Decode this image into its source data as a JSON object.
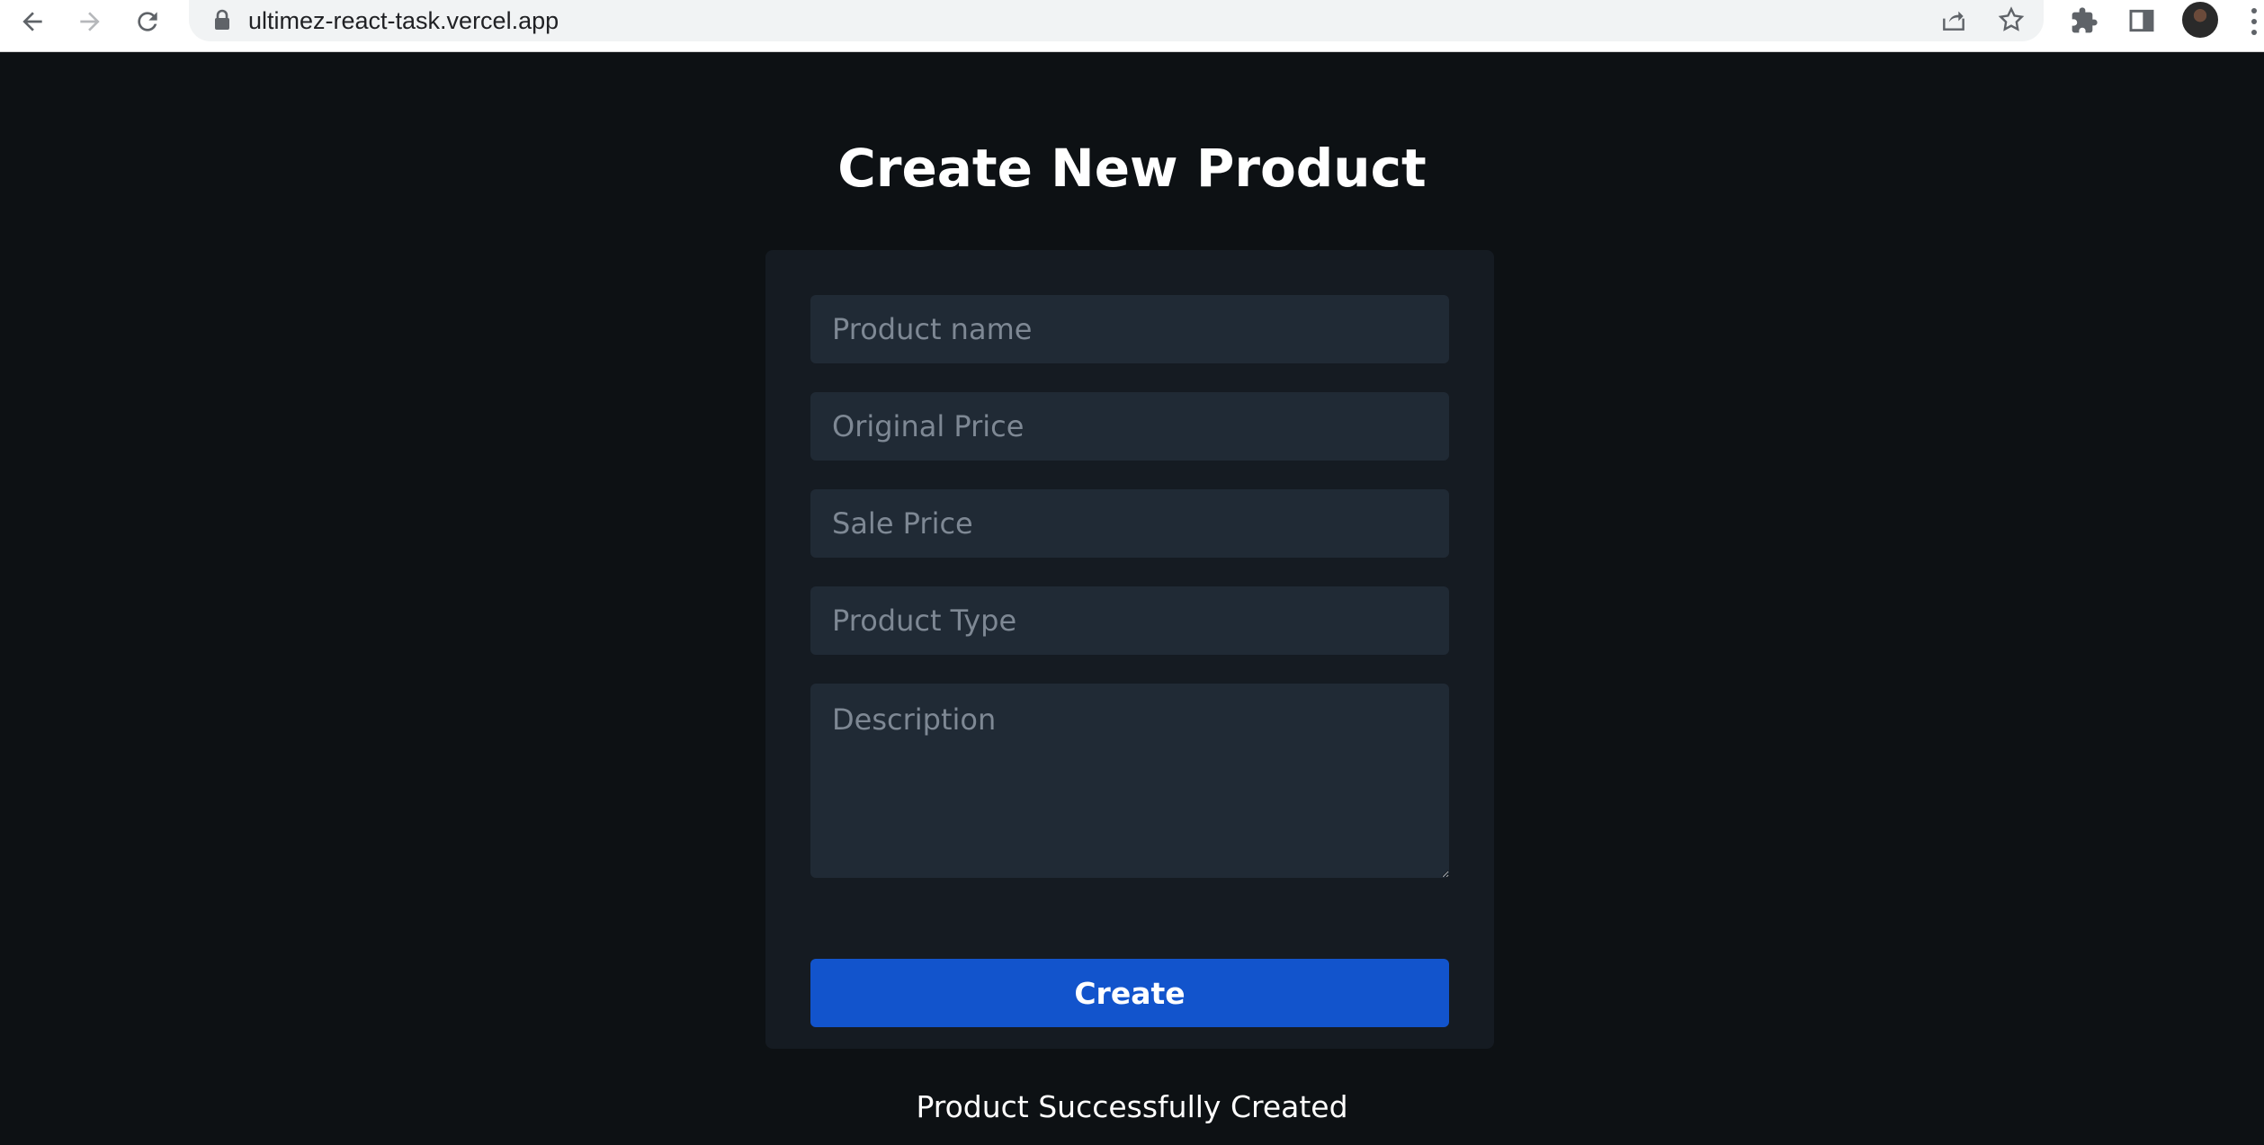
{
  "browser": {
    "url": "ultimez-react-task.vercel.app"
  },
  "page": {
    "title": "Create New Product"
  },
  "form": {
    "product_name_placeholder": "Product name",
    "original_price_placeholder": "Original Price",
    "sale_price_placeholder": "Sale Price",
    "product_type_placeholder": "Product Type",
    "description_placeholder": "Description",
    "create_label": "Create"
  },
  "status": {
    "message": "Product Successfully Created"
  },
  "colors": {
    "page_background": "#0d1114",
    "card_background": "#151b22",
    "field_background": "#202a35",
    "button_background": "#1254cc",
    "text": "#ffffff",
    "placeholder": "#7e8894"
  }
}
